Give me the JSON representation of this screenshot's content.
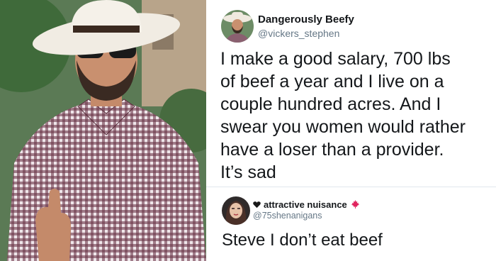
{
  "photo": {
    "subject": "man in cowboy hat giving a thumbs up",
    "icon": "person-photo"
  },
  "tweet_1": {
    "display_name": "Dangerously Beefy",
    "handle": "@vickers_stephen",
    "text": "I make a good salary, 700 lbs\nof beef a year and I live on a\ncouple hundred acres. And I\nswear you women would rather\nhave a loser than a provider.\nIt’s sad"
  },
  "tweet_2": {
    "display_name": "attractive nuisance",
    "handle": "@75shenanigans",
    "name_prefix_icon": "black-heart-icon",
    "name_suffix_icon": "maple-leaf-icon",
    "text": "Steve I don’t eat beef"
  },
  "colors": {
    "text_primary": "#14171a",
    "text_secondary": "#657786",
    "divider": "#e1e8ed",
    "flag_red": "#e0245e"
  }
}
